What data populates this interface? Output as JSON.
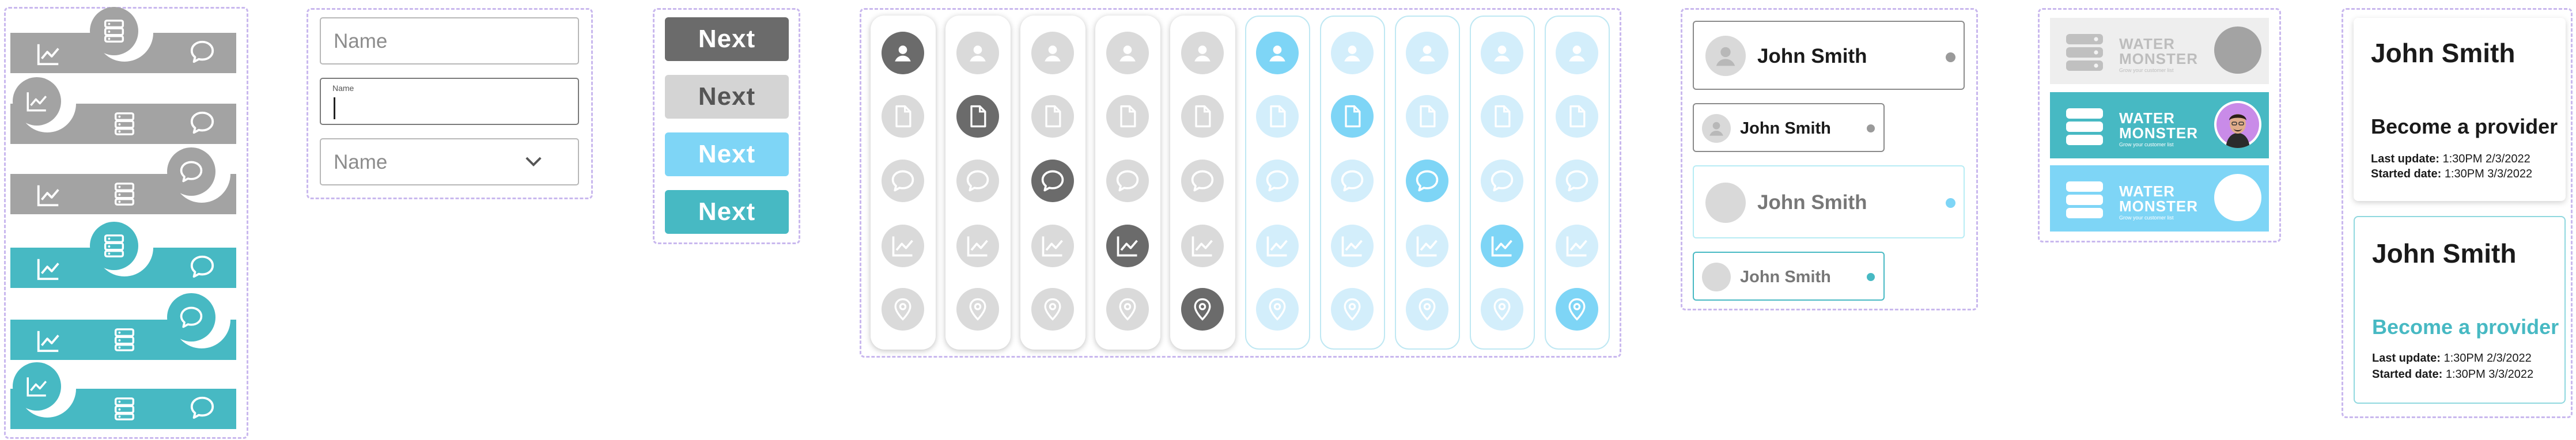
{
  "colors": {
    "gray": "#a3a3a3",
    "teal": "#47b9c3",
    "dark": "#6b6b6b",
    "light": "#d4d4d4",
    "sky": "#7ed5f6",
    "frame": "#c9b8ee"
  },
  "nav_icons": [
    "chart-icon",
    "server-icon",
    "chat-icon"
  ],
  "inputs": {
    "name_placeholder": "Name",
    "name_label": "Name",
    "select_value": "Name"
  },
  "buttons": {
    "b1": "Next",
    "b2": "Next",
    "b3": "Next",
    "b4": "Next"
  },
  "icon_grid_icons": [
    "user-icon",
    "document-icon",
    "chat-icon",
    "chart-icon",
    "location-icon"
  ],
  "user_cards": {
    "name1": "John Smith",
    "name2": "John Smith",
    "name3": "John Smith",
    "name4": "John Smith"
  },
  "brand": {
    "b1": {
      "line1": "WATER",
      "line2": "MONSTER",
      "subtitle": "Grow your customer list"
    },
    "b2": {
      "line1": "WATER",
      "line2": "MONSTER",
      "subtitle": "Grow your customer list"
    },
    "b3": {
      "line1": "WATER",
      "line2": "MONSTER",
      "subtitle": "Grow your customer list"
    }
  },
  "provider_cards": {
    "c1": {
      "name": "John Smith",
      "title": "Become a provider",
      "last_label": "Last update:",
      "last_value": "1:30PM 2/3/2022",
      "start_label": "Started date:",
      "start_value": "1:30PM 3/3/2022"
    },
    "c2": {
      "name": "John Smith",
      "title": "Become a provider",
      "last_label": "Last update:",
      "last_value": "1:30PM 2/3/2022",
      "start_label": "Started date:",
      "start_value": "1:30PM 3/3/2022"
    }
  }
}
